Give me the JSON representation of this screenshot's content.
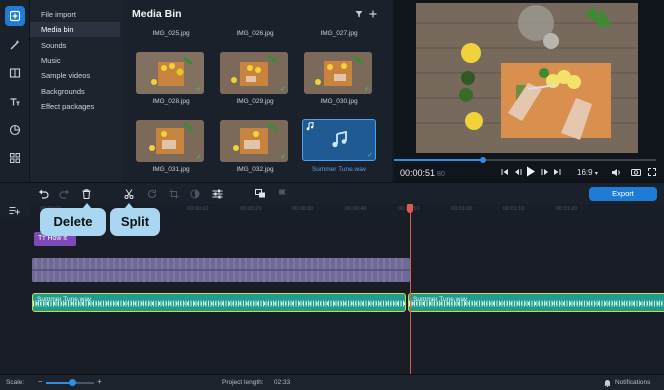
{
  "sidebar": {
    "items": [
      {
        "label": "File import",
        "active": false
      },
      {
        "label": "Media bin",
        "active": true
      },
      {
        "label": "Sounds",
        "active": false
      },
      {
        "label": "Music",
        "active": false
      },
      {
        "label": "Sample videos",
        "active": false
      },
      {
        "label": "Backgrounds",
        "active": false
      },
      {
        "label": "Effect packages",
        "active": false
      }
    ]
  },
  "media_bin": {
    "title": "Media Bin",
    "files": [
      {
        "name": "IMG_025.jpg"
      },
      {
        "name": "IMG_026.jpg"
      },
      {
        "name": "IMG_027.jpg"
      },
      {
        "name": "IMG_028.jpg"
      },
      {
        "name": "IMG_029.jpg"
      },
      {
        "name": "IMG_030.jpg"
      },
      {
        "name": "IMG_031.jpg"
      },
      {
        "name": "IMG_032.jpg"
      },
      {
        "name": "Summer Tune.wav"
      }
    ]
  },
  "player": {
    "time": "00:00:51",
    "time_frac": "80",
    "aspect": "16:9",
    "progress": 0.34
  },
  "toolbar": {
    "export_label": "Export"
  },
  "tooltips": {
    "delete": "Delete",
    "split": "Split"
  },
  "timeline": {
    "ticks": [
      "00:00:00",
      "00:00:10",
      "00:00:20",
      "00:00:30",
      "00:00:40",
      "00:00:50",
      "00:01:00",
      "00:01:10",
      "00:01:20"
    ],
    "text_clip": "How it",
    "audio_clip_1": "Summer Tune.wav",
    "audio_clip_2": "Summer Tune.wav"
  },
  "status": {
    "scale_label": "Scale:",
    "project_length_label": "Project length:",
    "project_length": "02:33",
    "notifications_label": "Notifications"
  },
  "colors": {
    "accent": "#1e7bd8",
    "audio": "#1f9c8c",
    "video": "#6a6690",
    "title": "#7d4bb8",
    "playhead": "#e05a4e"
  }
}
